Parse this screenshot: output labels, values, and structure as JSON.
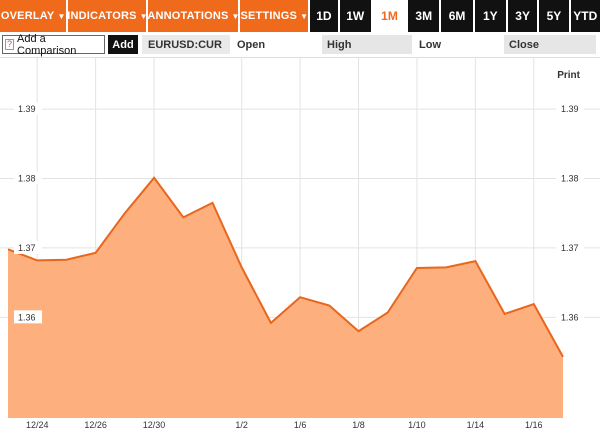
{
  "toolbar": {
    "menus": [
      {
        "label": "OVERLAY",
        "caret": "▼"
      },
      {
        "label": "INDICATORS",
        "caret": "▼"
      },
      {
        "label": "ANNOTATIONS",
        "caret": "▼"
      },
      {
        "label": "SETTINGS",
        "caret": "▼"
      }
    ],
    "ranges": [
      "1D",
      "1W",
      "1M",
      "3M",
      "6M",
      "1Y",
      "3Y",
      "5Y",
      "YTD"
    ],
    "active_range": "1M"
  },
  "compare": {
    "icon_text": "?",
    "add_comparison_label": "Add a Comparison",
    "add_label": "Add",
    "ticker": "EURUSD:CUR",
    "open_label": "Open",
    "high_label": "High",
    "low_label": "Low",
    "close_label": "Close"
  },
  "print_label": "Print",
  "colors": {
    "accent": "#f06a1c",
    "fill": "#fdb07e",
    "line": "#e8661d",
    "dark": "#111111"
  },
  "chart_data": {
    "type": "area",
    "x_tick_labels": [
      "12/24",
      "12/26",
      "12/30",
      "1/2",
      "1/6",
      "1/8",
      "1/10",
      "1/14",
      "1/16"
    ],
    "x_tick_index": [
      1,
      3,
      5,
      8,
      10,
      12,
      14,
      16,
      18
    ],
    "values": [
      1.3698,
      1.3682,
      1.3683,
      1.3693,
      1.375,
      1.3801,
      1.3744,
      1.3765,
      1.3672,
      1.3592,
      1.3629,
      1.3617,
      1.358,
      1.3607,
      1.3671,
      1.3672,
      1.3681,
      1.3605,
      1.3619,
      1.3543
    ],
    "y_ticks": [
      1.36,
      1.37,
      1.38,
      1.39
    ],
    "y_tick_labels": [
      "1.36",
      "1.37",
      "1.38",
      "1.39"
    ],
    "ylim": [
      1.3455,
      1.3975
    ],
    "grid": true
  }
}
